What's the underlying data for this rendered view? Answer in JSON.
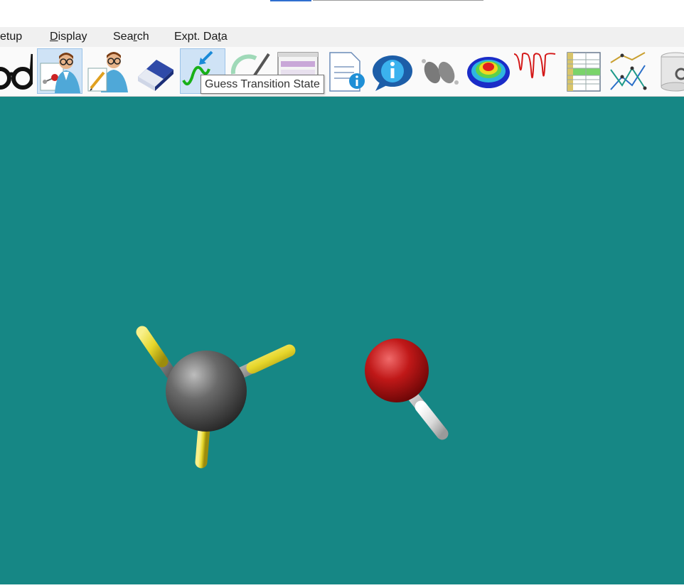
{
  "menu": {
    "items": [
      "etup",
      "Display",
      "Search",
      "Expt. Data"
    ]
  },
  "toolbar": {
    "buttons": [
      "glasses-icon",
      "build-molecule-icon",
      "edit-builder-icon",
      "eraser-icon",
      "guess-transition-state-icon",
      "measure-icon",
      "window-icon",
      "document-info-icon",
      "info-bubble-icon",
      "orbitals-icon",
      "potential-map-icon",
      "spectra-icon",
      "spreadsheet-icon",
      "plot-icon",
      "database-icon"
    ],
    "active": "guess-transition-state-icon"
  },
  "tooltip": {
    "text": "Guess Transition State"
  },
  "viewport": {
    "background": "#168785",
    "molecules": [
      {
        "name": "methyl",
        "atoms": [
          "C",
          "H",
          "H",
          "H"
        ]
      },
      {
        "name": "hydroxyl",
        "atoms": [
          "O",
          "H"
        ]
      }
    ]
  },
  "colors": {
    "carbon": "#6a6a6a",
    "hydrogen_highlight": "#e6d62a",
    "oxygen": "#c01818",
    "hydrogen": "#e6e6e6",
    "active_button": "#cfe3f6"
  }
}
